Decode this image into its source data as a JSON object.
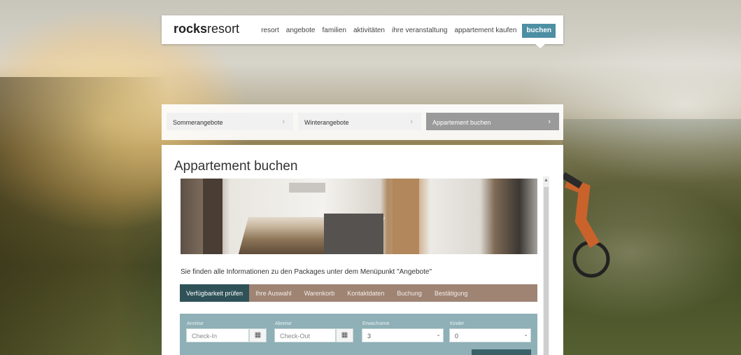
{
  "brand": {
    "logo_bold": "rocks",
    "logo_light": "resort"
  },
  "nav": {
    "items": [
      {
        "label": "resort"
      },
      {
        "label": "angebote"
      },
      {
        "label": "familien"
      },
      {
        "label": "aktivitäten"
      },
      {
        "label": "ihre veranstaltung"
      },
      {
        "label": "appartement kaufen"
      },
      {
        "label": "buchen"
      }
    ],
    "active_color": "#4d8fa3"
  },
  "offers": [
    {
      "label": "Sommerangebote",
      "icon": "chevron-right-icon"
    },
    {
      "label": "Winterangebote",
      "icon": "chevron-right-icon"
    },
    {
      "label": "Appartement buchen",
      "icon": "chevron-right-icon"
    }
  ],
  "page": {
    "title": "Appartement buchen",
    "info_text": "Sie finden alle Informationen zu den Packages unter dem Menüpunkt \"Angebote\""
  },
  "steps": [
    {
      "label": "Verfügbarkeit prüfen"
    },
    {
      "label": "Ihre Auswahl"
    },
    {
      "label": "Warenkorb"
    },
    {
      "label": "Kontaktdaten"
    },
    {
      "label": "Buchung"
    },
    {
      "label": "Bestätigung"
    }
  ],
  "form": {
    "arrival_label": "Anreise",
    "arrival_placeholder": "Check-In",
    "departure_label": "Abreise",
    "departure_placeholder": "Check-Out",
    "adults_label": "Erwachsene",
    "adults_value": "3",
    "children_label": "Kinder",
    "children_value": "0",
    "calendar_icon": "calendar-icon",
    "dropdown_icon": "chevron-down-icon"
  },
  "colors": {
    "steps_bar": "#9f8474",
    "steps_active": "#2f5258",
    "form_bg": "#8eb0b6"
  }
}
